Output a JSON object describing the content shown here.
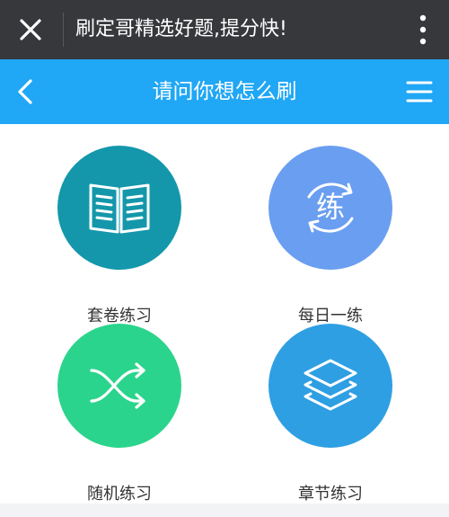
{
  "wechat_bar": {
    "title": "刷定哥精选好题,提分快!",
    "close_icon": "close-icon",
    "more_icon": "more-vertical-icon"
  },
  "app_bar": {
    "title": "请问你想怎么刷",
    "back_icon": "chevron-left-icon",
    "menu_icon": "menu-icon"
  },
  "colors": {
    "wechat_bar": "#36383b",
    "app_bar": "#20a7f5",
    "paper": "#1497ab",
    "daily": "#6a9ef0",
    "random": "#2bd48c",
    "chapter": "#2e9fe3"
  },
  "options": [
    {
      "label": "套卷练习",
      "icon": "book-icon"
    },
    {
      "label": "每日一练",
      "icon": "daily-practice-icon",
      "icon_text": "练"
    },
    {
      "label": "随机练习",
      "icon": "shuffle-icon"
    },
    {
      "label": "章节练习",
      "icon": "layers-icon"
    }
  ]
}
